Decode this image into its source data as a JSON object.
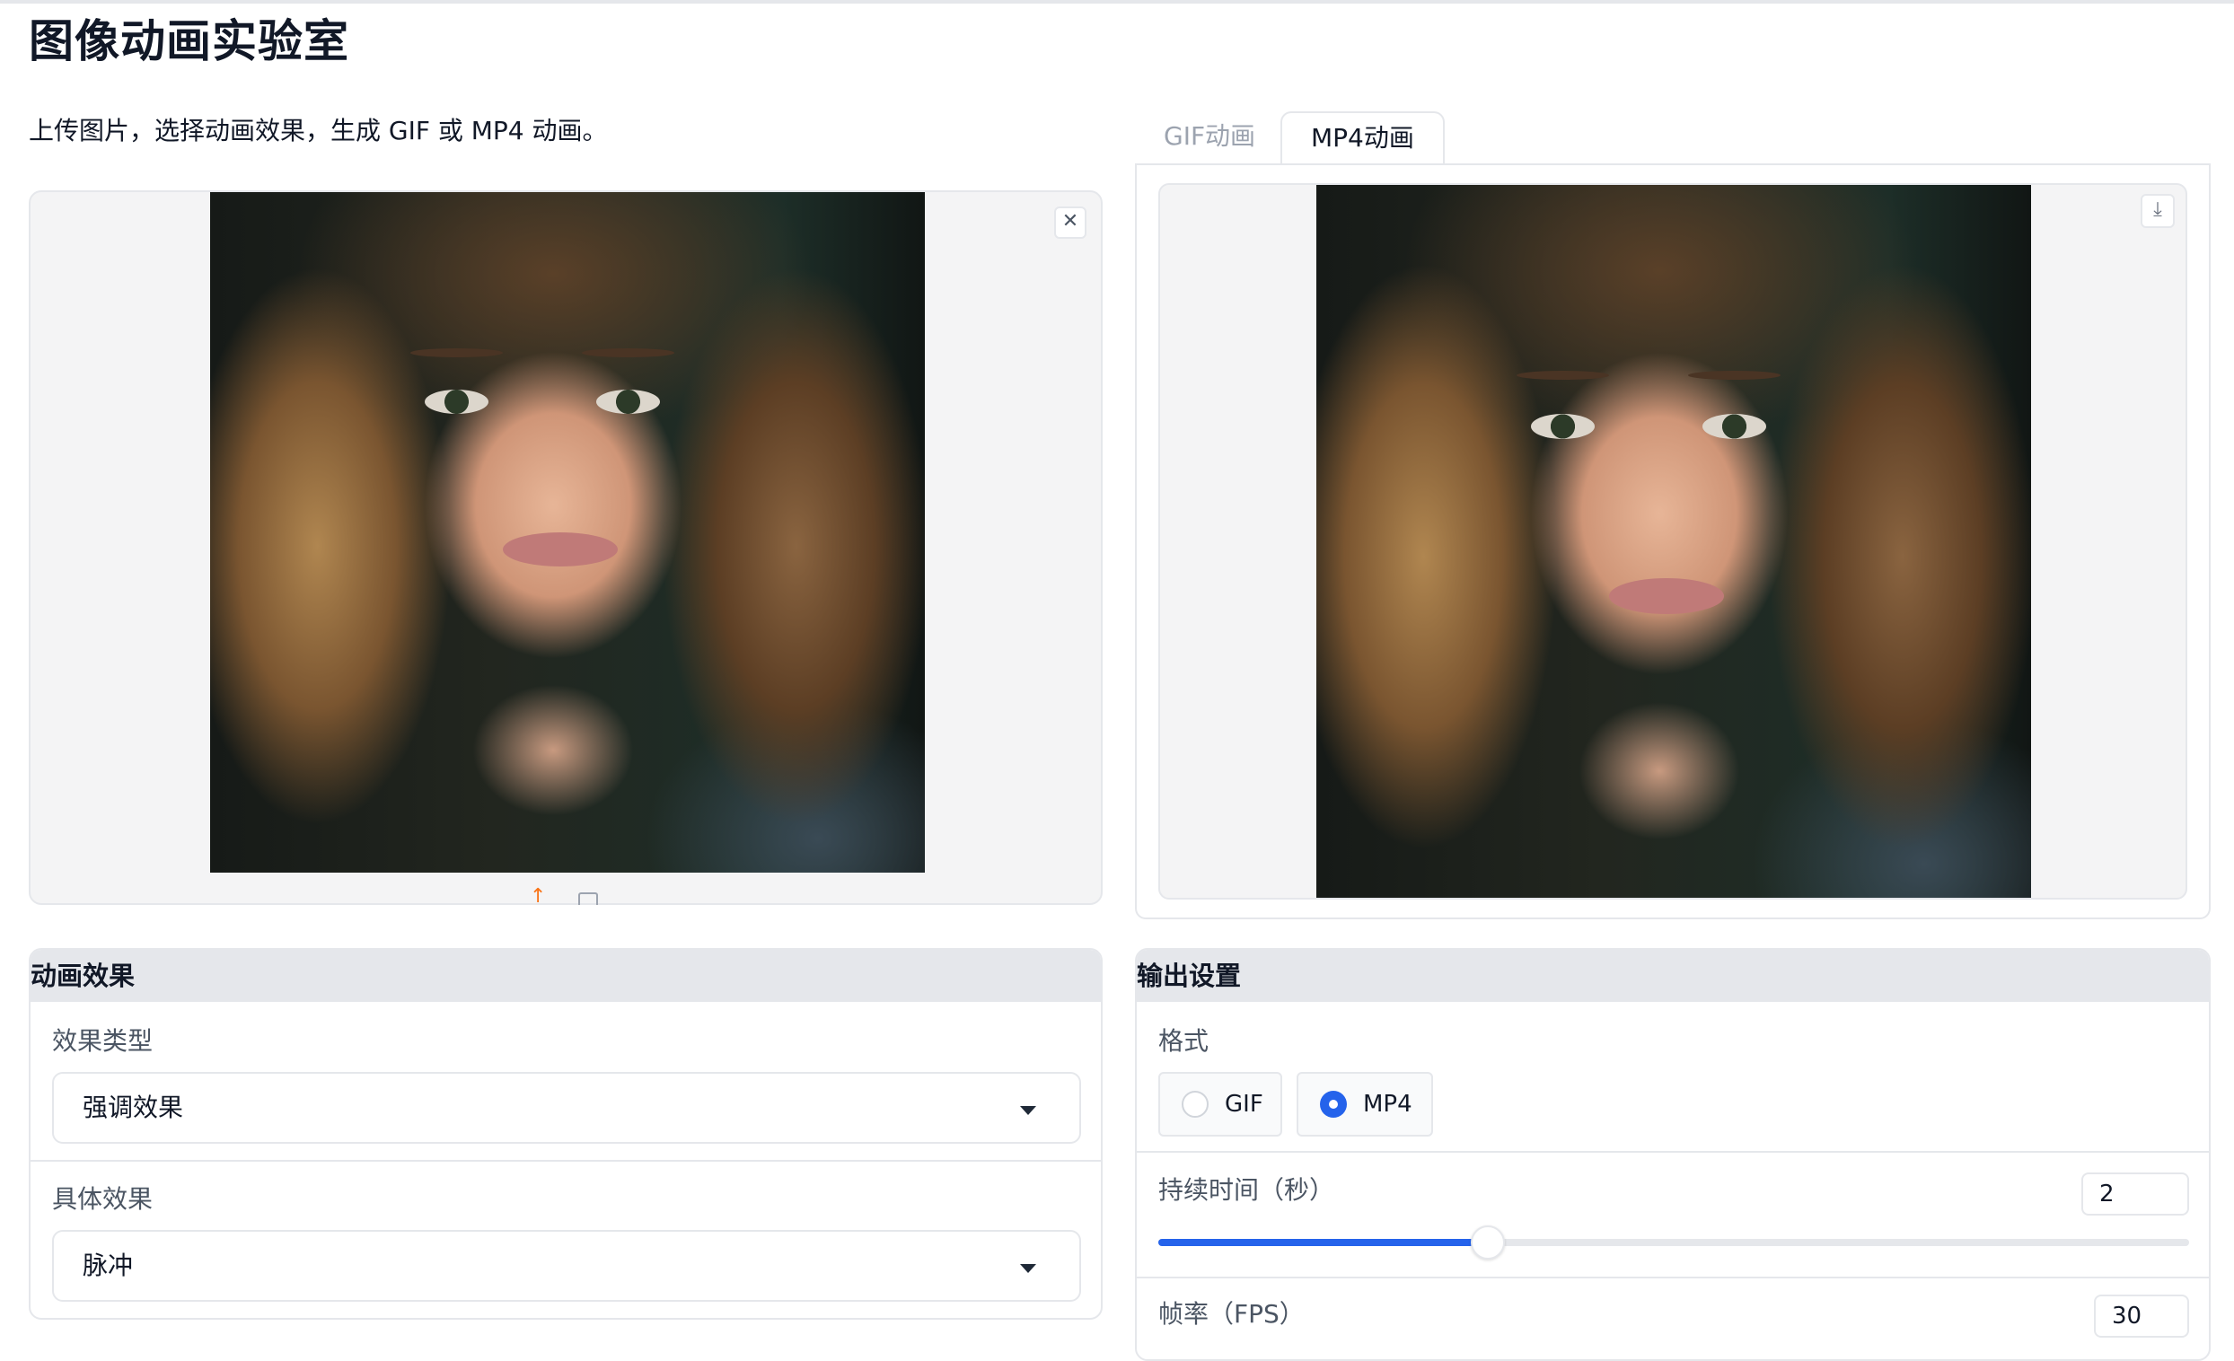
{
  "app": {
    "title": "图像动画实验室",
    "description": "上传图片，选择动画效果，生成 GIF 或 MP4 动画。"
  },
  "input_image": {
    "close_icon": "close-icon",
    "upload_icon": "upload-icon",
    "clipboard_icon": "clipboard-icon"
  },
  "tabs": [
    {
      "label": "GIF动画",
      "selected": false
    },
    {
      "label": "MP4动画",
      "selected": true
    }
  ],
  "output_video": {
    "download_icon": "download-icon"
  },
  "animation_effects": {
    "heading": "动画效果",
    "effect_type": {
      "label": "效果类型",
      "value": "强调效果"
    },
    "specific_effect": {
      "label": "具体效果",
      "value": "脉冲"
    }
  },
  "output_settings": {
    "heading": "输出设置",
    "format": {
      "label": "格式",
      "options": [
        "GIF",
        "MP4"
      ],
      "selected": "MP4"
    },
    "duration": {
      "label": "持续时间（秒）",
      "value": "2",
      "fill_fraction": 0.32
    },
    "fps": {
      "label": "帧率（FPS）",
      "value": "30"
    }
  },
  "colors": {
    "accent": "#2563eb",
    "upload_accent": "#f97316",
    "panel_bg": "#f4f4f5",
    "border": "#e5e7eb"
  }
}
